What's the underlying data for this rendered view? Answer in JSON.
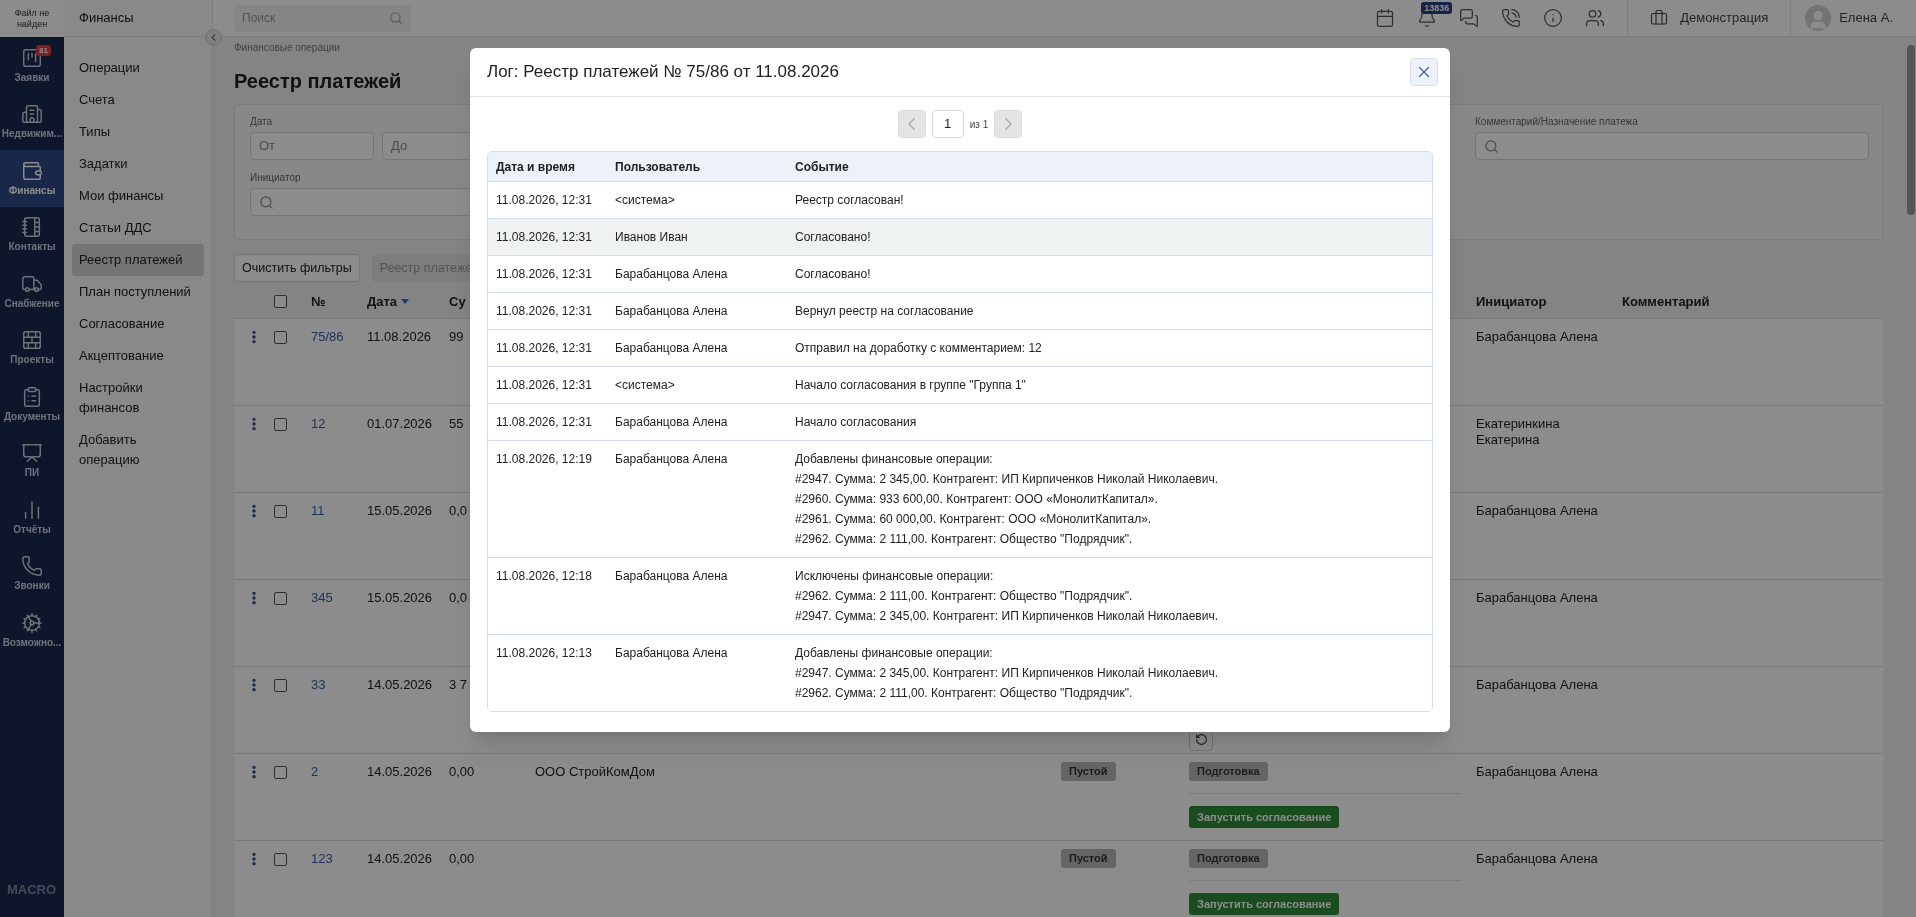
{
  "rail": {
    "logo_text": "Файл не найден",
    "brand": "MACRO",
    "items": [
      {
        "label": "Заявки",
        "badge": "81",
        "selected": false
      },
      {
        "label": "Недвижим...",
        "selected": false
      },
      {
        "label": "Финансы",
        "selected": true
      },
      {
        "label": "Контакты",
        "selected": false
      },
      {
        "label": "Снабжение",
        "selected": false
      },
      {
        "label": "Проекты",
        "selected": false
      },
      {
        "label": "Документы",
        "selected": false
      },
      {
        "label": "ПИ",
        "selected": false
      },
      {
        "label": "Отчёты",
        "selected": false
      },
      {
        "label": "Звонки",
        "selected": false
      },
      {
        "label": "Возможно...",
        "selected": false
      }
    ]
  },
  "sidebar": {
    "title": "Финансы",
    "items": [
      {
        "label": "Операции",
        "selected": false
      },
      {
        "label": "Счета",
        "selected": false
      },
      {
        "label": "Типы",
        "selected": false
      },
      {
        "label": "Задатки",
        "selected": false
      },
      {
        "label": "Мои финансы",
        "selected": false
      },
      {
        "label": "Статьи ДДС",
        "selected": false
      },
      {
        "label": "Реестр платежей",
        "selected": true
      },
      {
        "label": "План поступлений",
        "selected": false
      },
      {
        "label": "Согласование",
        "selected": false
      },
      {
        "label": "Акцептование",
        "selected": false
      },
      {
        "label": "Настройки финансов",
        "selected": false
      },
      {
        "label": "Добавить операцию",
        "selected": false
      }
    ]
  },
  "topbar": {
    "search_placeholder": "Поиск",
    "notifications_badge": "13836",
    "company": "Демонстрация",
    "user": "Елена А."
  },
  "page": {
    "breadcrumb": "Финансовые операции",
    "title": "Реестр платежей",
    "filters": {
      "date_label": "Дата",
      "from_placeholder": "От",
      "to_placeholder": "До",
      "initiator_label": "Инициатор",
      "comment_label": "Комментарий/Назначение платежа"
    },
    "buttons": [
      {
        "label": "Очистить фильтры",
        "disabled": false
      },
      {
        "label": "Реестр платеже",
        "disabled": true
      }
    ],
    "table": {
      "select_all_checked": false,
      "columns": [
        {
          "label": "№",
          "sorted": false
        },
        {
          "label": "Дата",
          "sorted": true
        },
        {
          "label": "Су",
          "sorted": false
        },
        {
          "label": "Инициатор",
          "sorted": false
        },
        {
          "label": "Комментарий",
          "sorted": false
        }
      ],
      "rows": [
        {
          "number": "75/86",
          "date": "11.08.2026",
          "sum": "99",
          "checked": false,
          "initiator": "Барабанцова Алена"
        },
        {
          "number": "12",
          "date": "01.07.2026",
          "sum": "55",
          "checked": false,
          "initiator": "Екатеринкина Екатерина"
        },
        {
          "number": "11",
          "date": "15.05.2026",
          "sum": "0,0",
          "checked": false,
          "initiator": "Барабанцова Алена"
        },
        {
          "number": "345",
          "date": "15.05.2026",
          "sum": "0,0",
          "checked": false,
          "initiator": "Барабанцова Алена"
        },
        {
          "number": "33",
          "date": "14.05.2026",
          "sum": "3 7",
          "checked": false,
          "action": {
            "kind": "refresh"
          },
          "initiator": "Барабанцова Алена"
        },
        {
          "number": "2",
          "date": "14.05.2026",
          "sum": "0,00",
          "checked": false,
          "counterparty": "ООО СтройКомДом",
          "type": "Пустой",
          "status": "Подготовка",
          "action": {
            "kind": "button",
            "label": "Запустить согласование"
          },
          "initiator": "Барабанцова Алена"
        },
        {
          "number": "123",
          "date": "14.05.2026",
          "sum": "0,00",
          "checked": false,
          "type": "Пустой",
          "status": "Подготовка",
          "action": {
            "kind": "button",
            "label": "Запустить согласование"
          },
          "initiator": "Барабанцова Алена"
        }
      ]
    }
  },
  "modal": {
    "title": "Лог: Реестр платежей № 75/86 от 11.08.2026",
    "pagination": {
      "page": "1",
      "of": "из 1",
      "prev_disabled": true,
      "next_disabled": true
    },
    "columns": [
      "Дата и время",
      "Пользователь",
      "Событие"
    ],
    "rows": [
      {
        "date": "11.08.2026, 12:31",
        "user": "<система>",
        "event": [
          "Реестр согласован!"
        ],
        "hovered": false
      },
      {
        "date": "11.08.2026, 12:31",
        "user": "Иванов Иван",
        "event": [
          "Согласовано!"
        ],
        "hovered": true
      },
      {
        "date": "11.08.2026, 12:31",
        "user": "Барабанцова Алена",
        "event": [
          "Согласовано!"
        ],
        "hovered": false
      },
      {
        "date": "11.08.2026, 12:31",
        "user": "Барабанцова Алена",
        "event": [
          "Вернул реестр на согласование"
        ],
        "hovered": false
      },
      {
        "date": "11.08.2026, 12:31",
        "user": "Барабанцова Алена",
        "event": [
          "Отправил на доработку с комментарием: 12"
        ],
        "hovered": false
      },
      {
        "date": "11.08.2026, 12:31",
        "user": "<система>",
        "event": [
          "Начало согласования в группе \"Группа 1\""
        ],
        "hovered": false
      },
      {
        "date": "11.08.2026, 12:31",
        "user": "Барабанцова Алена",
        "event": [
          "Начало согласования"
        ],
        "hovered": false
      },
      {
        "date": "11.08.2026, 12:19",
        "user": "Барабанцова Алена",
        "event": [
          "Добавлены финансовые операции:",
          "#2947. Сумма: 2 345,00. Контрагент: ИП Кирпиченков Николай Николаевич.",
          "#2960. Сумма: 933 600,00. Контрагент: ООО «МонолитКапитал».",
          "#2961. Сумма: 60 000,00. Контрагент: ООО «МонолитКапитал».",
          "#2962. Сумма: 2 111,00. Контрагент: Общество \"Подрядчик\"."
        ],
        "hovered": false
      },
      {
        "date": "11.08.2026, 12:18",
        "user": "Барабанцова Алена",
        "event": [
          "Исключены финансовые операции:",
          "#2962. Сумма: 2 111,00. Контрагент: Общество \"Подрядчик\".",
          "#2947. Сумма: 2 345,00. Контрагент: ИП Кирпиченков Николай Николаевич."
        ],
        "hovered": false
      },
      {
        "date": "11.08.2026, 12:13",
        "user": "Барабанцова Алена",
        "event": [
          "Добавлены финансовые операции:",
          "#2947. Сумма: 2 345,00. Контрагент: ИП Кирпиченков Николай Николаевич.",
          "#2962. Сумма: 2 111,00. Контрагент: Общество \"Подрядчик\"."
        ],
        "hovered": false
      }
    ]
  }
}
